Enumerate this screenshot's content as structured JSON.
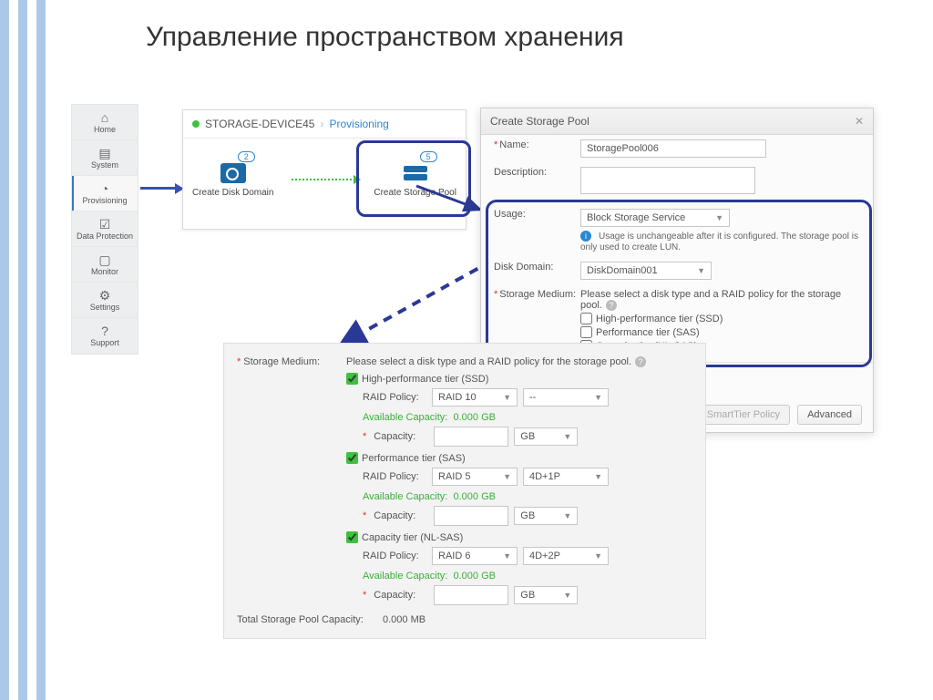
{
  "page_title": "Управление пространством хранения",
  "sidebar": {
    "items": [
      {
        "label": "Home"
      },
      {
        "label": "System"
      },
      {
        "label": "Provisioning"
      },
      {
        "label": "Data Protection"
      },
      {
        "label": "Monitor"
      },
      {
        "label": "Settings"
      },
      {
        "label": "Support"
      }
    ]
  },
  "breadcrumb": {
    "device": "STORAGE-DEVICE45",
    "current": "Provisioning"
  },
  "provisioning": {
    "disk_domain_label": "Create Disk Domain",
    "disk_domain_badge": "2",
    "storage_pool_label": "Create Storage Pool",
    "storage_pool_badge": "5"
  },
  "dialog": {
    "title": "Create Storage Pool",
    "name_label": "Name:",
    "name_value": "StoragePool006",
    "description_label": "Description:",
    "usage_label": "Usage:",
    "usage_value": "Block Storage Service",
    "usage_note": "Usage is unchangeable after it is configured. The storage pool is only used to create LUN.",
    "disk_domain_label": "Disk Domain:",
    "disk_domain_value": "DiskDomain001",
    "medium_label": "Storage Medium:",
    "medium_hint": "Please select a disk type and a RAID policy for the storage pool.",
    "tier_ssd": "High-performance tier (SSD)",
    "tier_sas": "Performance tier (SAS)",
    "tier_nlsas": "Capacity tier (NL-SAS)",
    "total_label": "Total Storage Pool Capacity:",
    "total_value": "0.000 MB",
    "btn_smarttier": "Set SmartTier Policy",
    "btn_advanced": "Advanced"
  },
  "detail": {
    "medium_label": "Storage Medium:",
    "hint": "Please select a disk type and a RAID policy for the storage pool.",
    "tiers": [
      {
        "name": "High-performance tier (SSD)",
        "raid": "RAID 10",
        "extra": "--",
        "avail_label": "Available Capacity:",
        "avail": "0.000 GB",
        "cap_label": "Capacity:",
        "unit": "GB"
      },
      {
        "name": "Performance tier (SAS)",
        "raid": "RAID 5",
        "extra": "4D+1P",
        "avail_label": "Available Capacity:",
        "avail": "0.000 GB",
        "cap_label": "Capacity:",
        "unit": "GB"
      },
      {
        "name": "Capacity tier (NL-SAS)",
        "raid": "RAID 6",
        "extra": "4D+2P",
        "avail_label": "Available Capacity:",
        "avail": "0.000 GB",
        "cap_label": "Capacity:",
        "unit": "GB"
      }
    ],
    "raid_policy_label": "RAID Policy:",
    "total_label": "Total Storage Pool Capacity:",
    "total_value": "0.000 MB"
  }
}
